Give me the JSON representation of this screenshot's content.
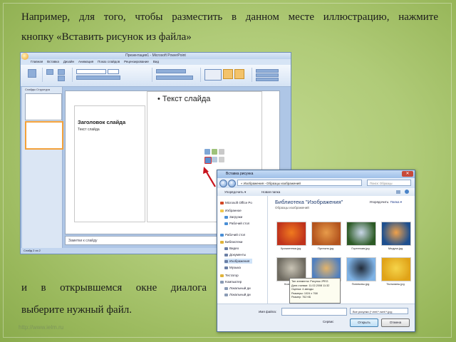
{
  "text": {
    "line1": "Например, для того, чтобы разместить в данном месте иллюстрацию, нажмите",
    "line2": "кнопку «Вставить рисунок из файла»",
    "line3": "и в открывшемся окне диалога",
    "line4": "выберите нужный файл.",
    "watermark": "http://www.ielm.ru"
  },
  "ppt": {
    "title": "Презентация1 - Microsoft PowerPoint",
    "tabs": [
      "Главная",
      "Вставка",
      "Дизайн",
      "Анимация",
      "Показ слайдов",
      "Рецензирование",
      "Вид"
    ],
    "slide_heading": "Заголовок слайда",
    "slide_subtext": "Текст слайда",
    "slide_bullet": "• Текст слайда",
    "notes": "Заметки к слайду",
    "status": "Слайд 2 из 2",
    "side_tabs": "Слайды   Структура"
  },
  "dialog": {
    "title": "Вставка рисунка",
    "address": "« Изображения › Образцы изображений",
    "search_placeholder": "Поиск: Образцы изображений",
    "organize": "Упорядочить ▾",
    "new_folder": "Новая папка",
    "nav_items": [
      {
        "label": "Microsoft Office Po",
        "color": "#d24726"
      },
      {
        "label": "Избранное",
        "color": "#f2c94c"
      },
      {
        "label": "Загрузки",
        "color": "#4a8fd6"
      },
      {
        "label": "Рабочий стол",
        "color": "#4a8fd6"
      },
      {
        "label": "Рабочий стол",
        "color": "#4a8fd6"
      },
      {
        "label": "Библиотеки",
        "color": "#e0b33a"
      },
      {
        "label": "Видео",
        "color": "#6b7fa5"
      },
      {
        "label": "Документы",
        "color": "#6b7fa5"
      },
      {
        "label": "Изображения",
        "color": "#6b7fa5"
      },
      {
        "label": "Музыка",
        "color": "#6b7fa5"
      },
      {
        "label": "Тестатор",
        "color": "#e0b33a"
      },
      {
        "label": "Компьютер",
        "color": "#8a9bb5"
      },
      {
        "label": "Локальный ди",
        "color": "#8a9bb5"
      },
      {
        "label": "Локальный ди",
        "color": "#8a9bb5"
      }
    ],
    "library_title": "Библиотека \"Изображения\"",
    "library_sub": "Образцы изображений",
    "arrange_label": "Упорядочить:",
    "arrange_value": "Папка ▾",
    "files": [
      {
        "name": "Хризантема.jpg",
        "c1": "#c0331c",
        "c2": "#f07a1f"
      },
      {
        "name": "Пустыня.jpg",
        "c1": "#b3541e",
        "c2": "#e79b4a"
      },
      {
        "name": "Гортензия.jpg",
        "c1": "#2c5a25",
        "c2": "#c9d7e8"
      },
      {
        "name": "Медуза.jpg",
        "c1": "#1d4f8f",
        "c2": "#f0a14a"
      },
      {
        "name": "Коала.jpg",
        "c1": "#6e6a60",
        "c2": "#c9c4b5"
      },
      {
        "name": "Маяк.jpg",
        "c1": "#4f7fc0",
        "c2": "#e4b46a"
      },
      {
        "name": "Пингвины.jpg",
        "c1": "#7fb3e6",
        "c2": "#222c3a"
      },
      {
        "name": "Тюльпаны.jpg",
        "c1": "#e0a318",
        "c2": "#f5d44a"
      }
    ],
    "tooltip": [
      "Тип элемента: Рисунок JPEG",
      "Дата съемки: 11.02.2008 11:32",
      "Оценка: 4 звезды",
      "Размеры: 1024 x 768",
      "Размер: 762 КБ"
    ],
    "filename_label": "Имя файла:",
    "filetype": "Все рисунки (*.emf;*.wmf;*.jpg;",
    "service": "Сервис",
    "open": "Открыть",
    "cancel": "Отмена"
  }
}
